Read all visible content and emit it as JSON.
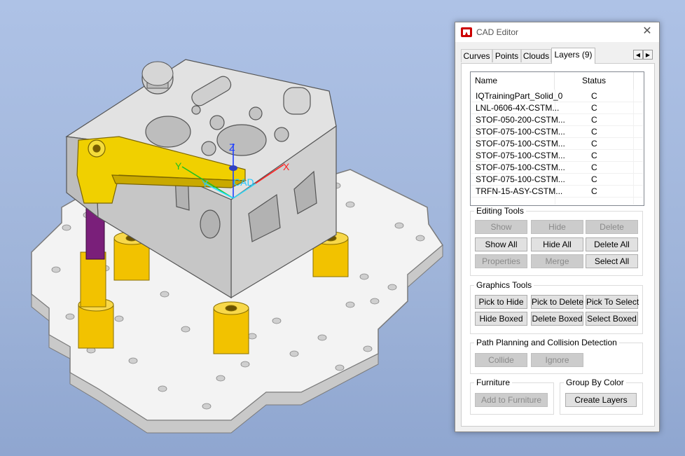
{
  "viewport": {
    "axis_labels": {
      "z": "Z",
      "y1": "Y",
      "y2": "Y",
      "x": "X",
      "cad": "CAD"
    },
    "colors": {
      "background": "#a8bde3",
      "fixture_plate": "#f4f4f4",
      "block": "#d9d9d9",
      "clamp": "#f0d000",
      "standoff": "#f2c200",
      "rod": "#7a1f7a"
    }
  },
  "dialog": {
    "title": "CAD Editor",
    "close_glyph": "✕",
    "tabs": [
      "Curves",
      "Points",
      "Clouds",
      "Layers (9)"
    ],
    "active_tab": "Layers (9)",
    "scroll_left": "◀",
    "scroll_right": "▶",
    "layer_list": {
      "headers": {
        "name": "Name",
        "status": "Status"
      },
      "rows": [
        {
          "name": "IQTrainingPart_Solid_0",
          "status": "C"
        },
        {
          "name": "LNL-0606-4X-CSTM...",
          "status": "C"
        },
        {
          "name": "STOF-050-200-CSTM...",
          "status": "C"
        },
        {
          "name": "STOF-075-100-CSTM...",
          "status": "C"
        },
        {
          "name": "STOF-075-100-CSTM...",
          "status": "C"
        },
        {
          "name": "STOF-075-100-CSTM...",
          "status": "C"
        },
        {
          "name": "STOF-075-100-CSTM...",
          "status": "C"
        },
        {
          "name": "STOF-075-100-CSTM...",
          "status": "C"
        },
        {
          "name": "TRFN-15-ASY-CSTM...",
          "status": "C"
        }
      ]
    },
    "editing_tools": {
      "label": "Editing Tools",
      "show": "Show",
      "hide": "Hide",
      "delete": "Delete",
      "show_all": "Show All",
      "hide_all": "Hide All",
      "delete_all": "Delete All",
      "properties": "Properties",
      "merge": "Merge",
      "select_all": "Select All"
    },
    "graphics_tools": {
      "label": "Graphics Tools",
      "pick_to_hide": "Pick to Hide",
      "pick_to_delete": "Pick to Delete",
      "pick_to_select": "Pick To Select",
      "hide_boxed": "Hide Boxed",
      "delete_boxed": "Delete Boxed",
      "select_boxed": "Select Boxed"
    },
    "path_planning": {
      "label": "Path Planning and Collision Detection",
      "collide": "Collide",
      "ignore": "Ignore"
    },
    "furniture": {
      "label": "Furniture",
      "add": "Add to Furniture"
    },
    "group_by_color": {
      "label": "Group By Color",
      "create": "Create Layers"
    }
  }
}
